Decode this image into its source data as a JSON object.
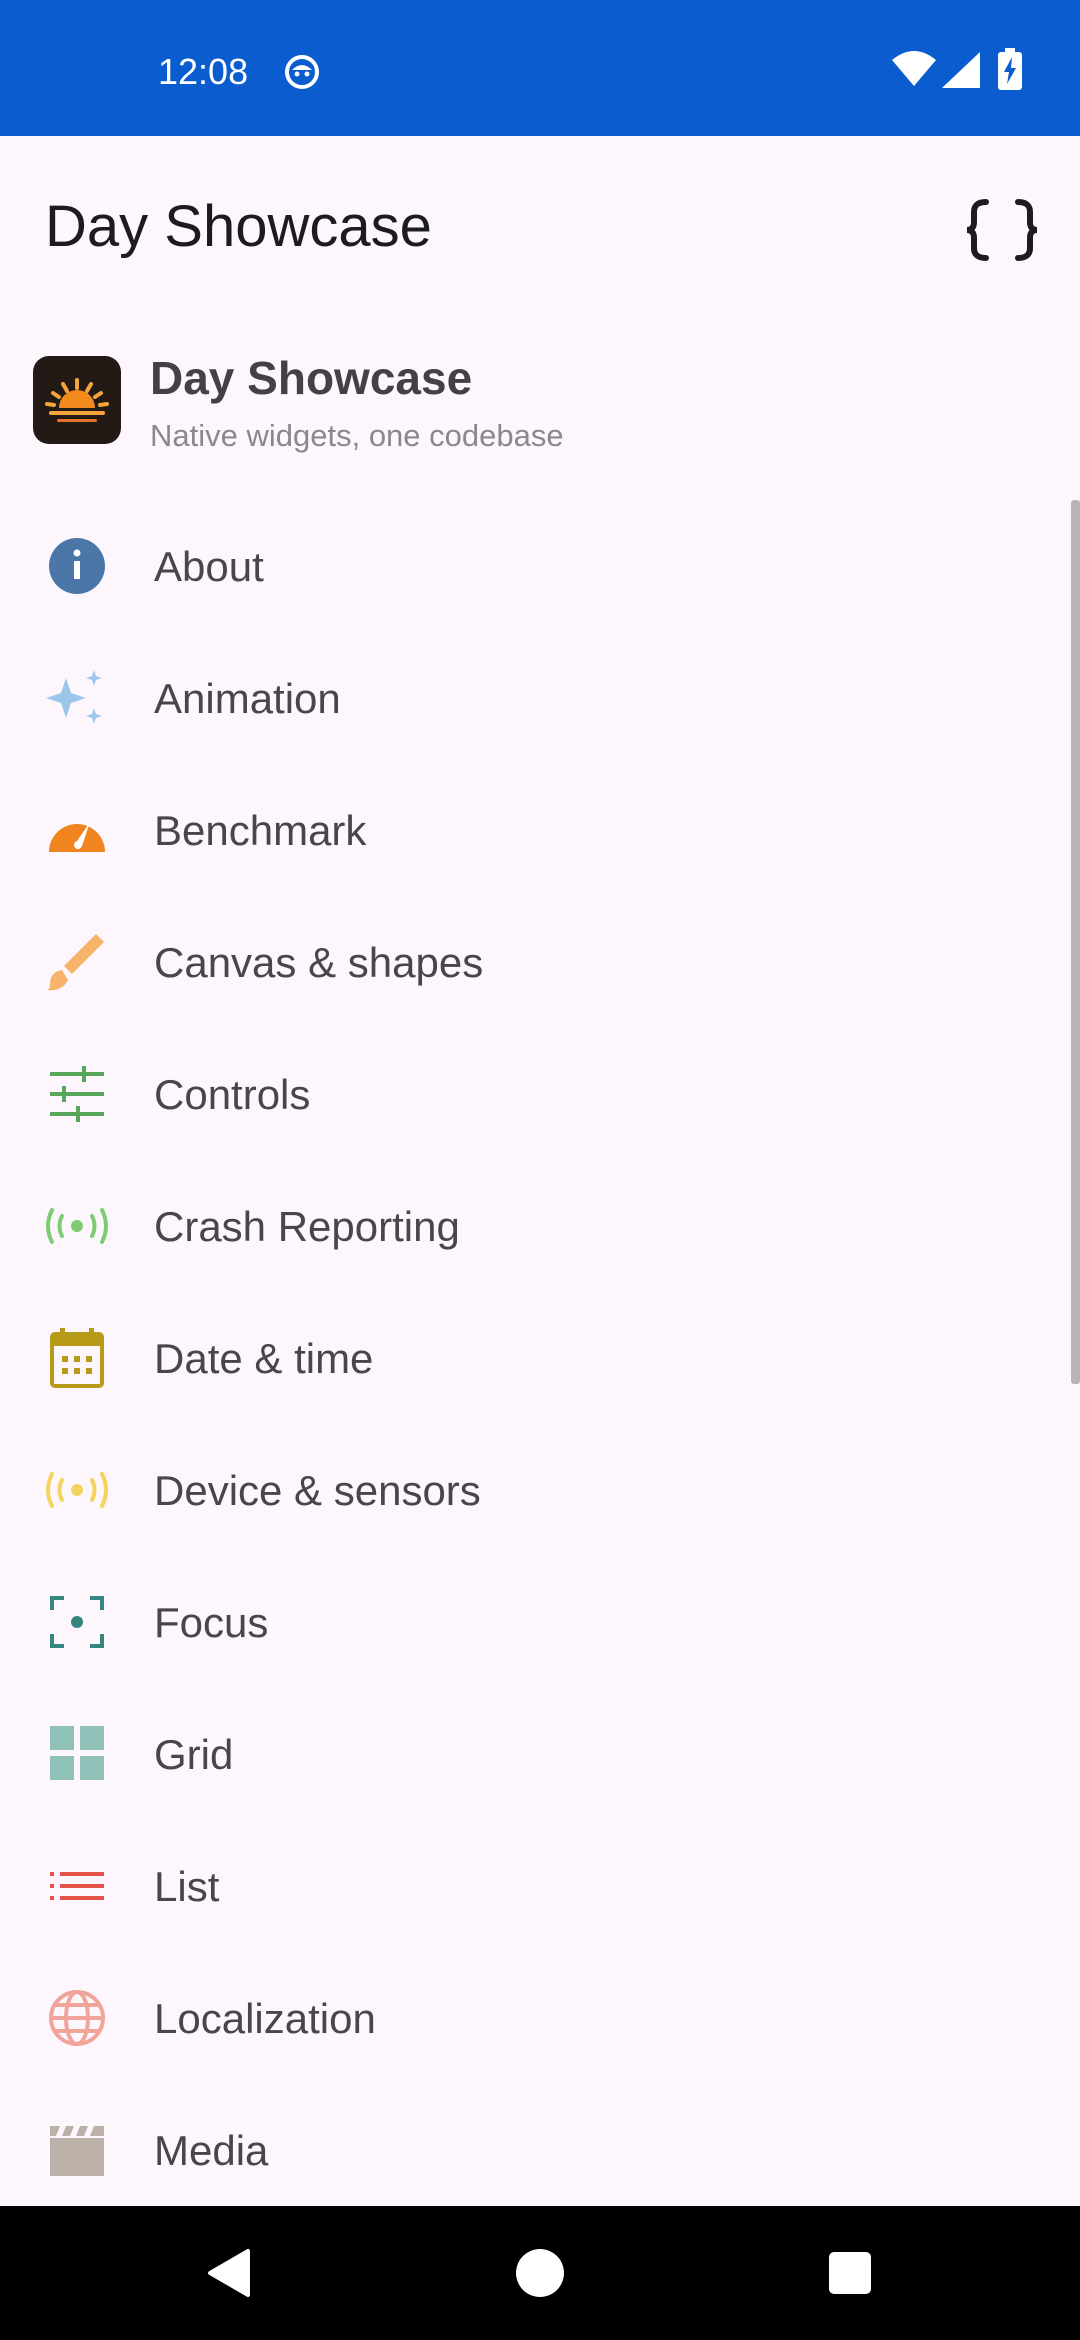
{
  "status_bar": {
    "time": "12:08",
    "icons": [
      "app-notification-icon",
      "wifi-icon",
      "cell-signal-icon",
      "battery-charging-icon"
    ],
    "bg_color": "#0b5ccf"
  },
  "app_bar": {
    "title": "Day Showcase",
    "action_icon": "code-braces-icon"
  },
  "drawer_header": {
    "name": "Day Showcase",
    "subtitle": "Native widgets, one codebase",
    "logo_icon": "sunrise-logo-icon"
  },
  "menu": {
    "items": [
      {
        "label": "About",
        "icon": "info-icon",
        "color": "#4a77a8"
      },
      {
        "label": "Animation",
        "icon": "sparkles-icon",
        "color": "#9cc7ea"
      },
      {
        "label": "Benchmark",
        "icon": "speedometer-icon",
        "color": "#f0841f"
      },
      {
        "label": "Canvas & shapes",
        "icon": "paintbrush-icon",
        "color": "#f8b36a"
      },
      {
        "label": "Controls",
        "icon": "sliders-icon",
        "color": "#58a55c"
      },
      {
        "label": "Crash Reporting",
        "icon": "broadcast-icon",
        "color": "#7dcc74"
      },
      {
        "label": "Date & time",
        "icon": "calendar-icon",
        "color": "#b79a18"
      },
      {
        "label": "Device & sensors",
        "icon": "sensor-icon",
        "color": "#f2d45e"
      },
      {
        "label": "Focus",
        "icon": "focus-icon",
        "color": "#35867e"
      },
      {
        "label": "Grid",
        "icon": "grid-icon",
        "color": "#8fc1b8"
      },
      {
        "label": "List",
        "icon": "list-icon",
        "color": "#e5534b"
      },
      {
        "label": "Localization",
        "icon": "globe-icon",
        "color": "#f0a49a"
      },
      {
        "label": "Media",
        "icon": "clapperboard-icon",
        "color": "#bcb1a9"
      }
    ]
  },
  "nav_bar": {
    "buttons": [
      "back-icon",
      "home-icon",
      "recents-icon"
    ]
  }
}
